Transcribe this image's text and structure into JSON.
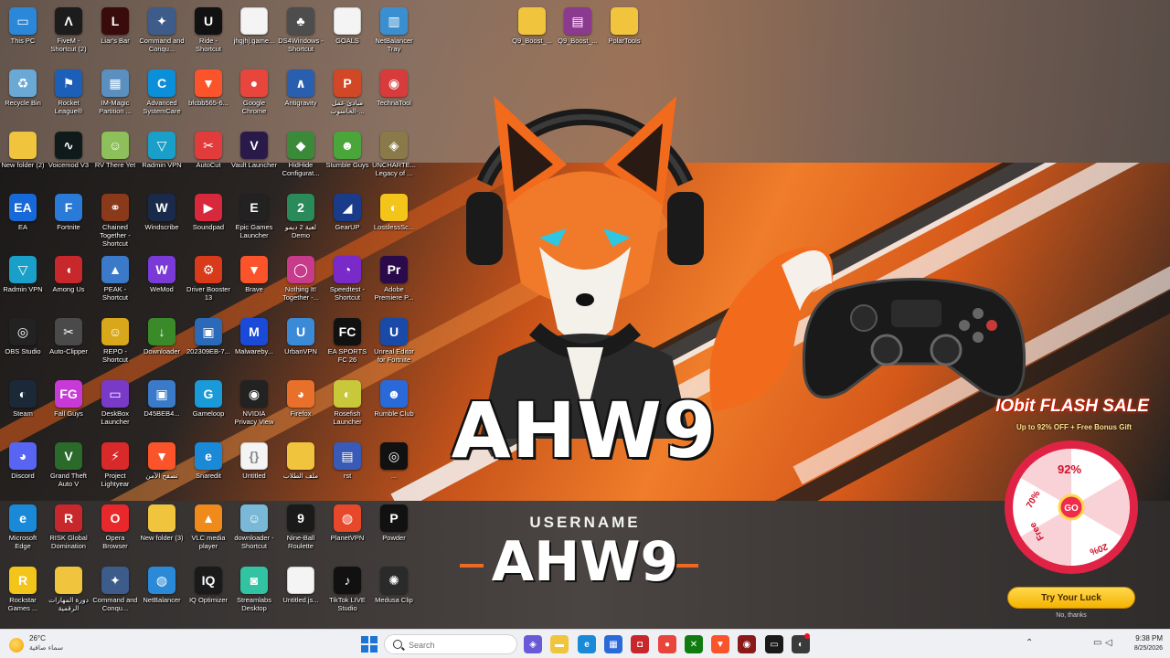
{
  "wallpaper": {
    "brand_text": "AHW9",
    "username_label": "USERNAME",
    "username_value": "AHW9"
  },
  "desktop_icons": [
    {
      "label": "This PC",
      "icon": "monitor-icon",
      "color": "#2b87d8",
      "glyph": "▭"
    },
    {
      "label": "FiveM - Shortcut (2)",
      "icon": "fivem-icon",
      "color": "#1c1c1c",
      "glyph": "Λ"
    },
    {
      "label": "Liar's Bar",
      "icon": "liars-bar-icon",
      "color": "#3a0b0b",
      "glyph": "L"
    },
    {
      "label": "Command and Conqu...",
      "icon": "command-conquer-icon",
      "color": "#3d5c8a",
      "glyph": "✦"
    },
    {
      "label": "Ride - Shortcut",
      "icon": "unreal-icon",
      "color": "#111111",
      "glyph": "U"
    },
    {
      "label": "jhgjhj.game...",
      "icon": "document-icon",
      "color": "#f4f4f4",
      "glyph": ""
    },
    {
      "label": "DS4Windows - Shortcut",
      "icon": "ds4windows-icon",
      "color": "#4d4d4d",
      "glyph": "♣"
    },
    {
      "label": "GOALS",
      "icon": "document-icon",
      "color": "#f4f4f4",
      "glyph": ""
    },
    {
      "label": "NetBalancer Tray",
      "icon": "netbalancer-icon",
      "color": "#3a8fd0",
      "glyph": "▥"
    },
    {
      "label": "Q9_Boost_...",
      "icon": "folder-icon",
      "color": "#f0c43c",
      "glyph": ""
    },
    {
      "label": "Q9_Boost_...",
      "icon": "winrar-icon",
      "color": "#8b3a8f",
      "glyph": "▤"
    },
    {
      "label": "PolarTools",
      "icon": "folder-icon",
      "color": "#f0c43c",
      "glyph": ""
    },
    {
      "label": "Recycle Bin",
      "icon": "recycle-bin-icon",
      "color": "#6aa9d6",
      "glyph": "♻"
    },
    {
      "label": "Rocket League®",
      "icon": "rocket-league-icon",
      "color": "#1b5fb8",
      "glyph": "⚑"
    },
    {
      "label": "IM-Magic Partition ...",
      "icon": "im-magic-icon",
      "color": "#5a8fc0",
      "glyph": "▦"
    },
    {
      "label": "Advanced SystemCare",
      "icon": "advanced-systemcare-icon",
      "color": "#0b8fd8",
      "glyph": "C"
    },
    {
      "label": "bfcbb565-6...",
      "icon": "brave-icon",
      "color": "#fb542b",
      "glyph": "▼"
    },
    {
      "label": "Google Chrome",
      "icon": "chrome-icon",
      "color": "#e8453c",
      "glyph": "●"
    },
    {
      "label": "Antigravity",
      "icon": "antigravity-icon",
      "color": "#2a5fb0",
      "glyph": "∧"
    },
    {
      "label": "مبادئ عمل الحاسوب-...",
      "icon": "powerpoint-icon",
      "color": "#d24726",
      "glyph": "P"
    },
    {
      "label": "TechnaTool",
      "icon": "technatool-icon",
      "color": "#d83b3b",
      "glyph": "◉"
    },
    {
      "label": "New folder (2)",
      "icon": "folder-icon",
      "color": "#f0c43c",
      "glyph": ""
    },
    {
      "label": "Voicemod V3",
      "icon": "voicemod-icon",
      "color": "#0f1a1a",
      "glyph": "∿"
    },
    {
      "label": "RV There Yet",
      "icon": "rv-there-yet-icon",
      "color": "#8dbf5a",
      "glyph": "☺"
    },
    {
      "label": "Radmin VPN",
      "icon": "radmin-vpn-icon",
      "color": "#1aa0c8",
      "glyph": "▽"
    },
    {
      "label": "AutoCut",
      "icon": "autocut-icon",
      "color": "#e23b3b",
      "glyph": "✂"
    },
    {
      "label": "Vault Launcher",
      "icon": "vault-launcher-icon",
      "color": "#2a1a4a",
      "glyph": "V"
    },
    {
      "label": "HidHide Configurat...",
      "icon": "hidhide-icon",
      "color": "#3a8a3a",
      "glyph": "◆"
    },
    {
      "label": "Stumble Guys",
      "icon": "stumble-guys-icon",
      "color": "#4aa63a",
      "glyph": "☻"
    },
    {
      "label": "UNCHARTE... Legacy of ...",
      "icon": "uncharted-icon",
      "color": "#8a7a4a",
      "glyph": "◈"
    },
    {
      "label": "EA",
      "icon": "ea-icon",
      "color": "#1768d8",
      "glyph": "EA"
    },
    {
      "label": "Fortnite",
      "icon": "fortnite-icon",
      "color": "#2a7ad8",
      "glyph": "F"
    },
    {
      "label": "Chained Together - Shortcut",
      "icon": "chained-together-icon",
      "color": "#8a3a1a",
      "glyph": "⚭"
    },
    {
      "label": "Windscribe",
      "icon": "windscribe-icon",
      "color": "#1a2a4a",
      "glyph": "W"
    },
    {
      "label": "Soundpad",
      "icon": "soundpad-icon",
      "color": "#d8283b",
      "glyph": "▶"
    },
    {
      "label": "Epic Games Launcher",
      "icon": "epic-games-icon",
      "color": "#222222",
      "glyph": "E"
    },
    {
      "label": "لعبة 2 ديمو Demo",
      "icon": "game-demo-icon",
      "color": "#2a8a5a",
      "glyph": "2"
    },
    {
      "label": "GearUP",
      "icon": "gearup-icon",
      "color": "#1a3a8a",
      "glyph": "◢"
    },
    {
      "label": "LosslessSc...",
      "icon": "lossless-scaling-icon",
      "color": "#f3c41a",
      "glyph": "◐"
    },
    {
      "label": "Radmin VPN",
      "icon": "radmin-vpn-icon",
      "color": "#1aa0c8",
      "glyph": "▽"
    },
    {
      "label": "Among Us",
      "icon": "among-us-icon",
      "color": "#c8282b",
      "glyph": "◖"
    },
    {
      "label": "PEAK - Shortcut",
      "icon": "peak-icon",
      "color": "#3a7ac8",
      "glyph": "▲"
    },
    {
      "label": "WeMod",
      "icon": "wemod-icon",
      "color": "#7a3ad8",
      "glyph": "W"
    },
    {
      "label": "Driver Booster 13",
      "icon": "driver-booster-icon",
      "color": "#d83a1a",
      "glyph": "⚙"
    },
    {
      "label": "Brave",
      "icon": "brave-icon",
      "color": "#fb542b",
      "glyph": "▼"
    },
    {
      "label": "Nothing It! Together -...",
      "icon": "nothing-together-icon",
      "color": "#c83a8a",
      "glyph": "◯"
    },
    {
      "label": "Speedtest - Shortcut",
      "icon": "speedtest-icon",
      "color": "#7a2ac8",
      "glyph": "◔"
    },
    {
      "label": "Adobe Premiere P...",
      "icon": "premiere-pro-icon",
      "color": "#2a0a4a",
      "glyph": "Pr"
    },
    {
      "label": "OBS Studio",
      "icon": "obs-icon",
      "color": "#222222",
      "glyph": "◎"
    },
    {
      "label": "Auto-Clipper",
      "icon": "auto-clipper-icon",
      "color": "#4a4a4a",
      "glyph": "✂"
    },
    {
      "label": "REPO - Shortcut",
      "icon": "repo-icon",
      "color": "#d8a81a",
      "glyph": "☺"
    },
    {
      "label": "Downloader",
      "icon": "downloader-icon",
      "color": "#3a8a2a",
      "glyph": "↓"
    },
    {
      "label": "202309EB-7...",
      "icon": "image-icon",
      "color": "#2a6ab8",
      "glyph": "▣"
    },
    {
      "label": "Malwareby...",
      "icon": "malwarebytes-icon",
      "color": "#1a4ad8",
      "glyph": "M"
    },
    {
      "label": "UrbanVPN",
      "icon": "urban-vpn-icon",
      "color": "#3a8ad8",
      "glyph": "U"
    },
    {
      "label": "EA SPORTS FC 26",
      "icon": "ea-fc-icon",
      "color": "#111111",
      "glyph": "FC"
    },
    {
      "label": "Unreal Editor for Fortnite",
      "icon": "unreal-editor-icon",
      "color": "#1a4aa8",
      "glyph": "U"
    },
    {
      "label": "Steam",
      "icon": "steam-icon",
      "color": "#1b2838",
      "glyph": "◐"
    },
    {
      "label": "Fall Guys",
      "icon": "fall-guys-icon",
      "color": "#c83ad8",
      "glyph": "FG"
    },
    {
      "label": "DeskBox Launcher",
      "icon": "deskbox-icon",
      "color": "#7a3ac8",
      "glyph": "▭"
    },
    {
      "label": "D45BEB4...",
      "icon": "image-icon",
      "color": "#3a7ac8",
      "glyph": "▣"
    },
    {
      "label": "Gameloop",
      "icon": "gameloop-icon",
      "color": "#1a9ad8",
      "glyph": "G"
    },
    {
      "label": "NVIDIA Privacy View",
      "icon": "privacy-view-icon",
      "color": "#222222",
      "glyph": "◉"
    },
    {
      "label": "Firefox",
      "icon": "firefox-icon",
      "color": "#e8702a",
      "glyph": "◕"
    },
    {
      "label": "Rosefish Launcher",
      "icon": "rosefish-icon",
      "color": "#c8c83a",
      "glyph": "◐"
    },
    {
      "label": "Rumble Club",
      "icon": "rumble-club-icon",
      "color": "#2a6ad8",
      "glyph": "☻"
    },
    {
      "label": "Discord",
      "icon": "discord-icon",
      "color": "#5865f2",
      "glyph": "◕"
    },
    {
      "label": "Grand Theft Auto V",
      "icon": "gta-v-icon",
      "color": "#2a6a2a",
      "glyph": "V"
    },
    {
      "label": "Project Lightyear",
      "icon": "project-icon",
      "color": "#d82a2a",
      "glyph": "⚡"
    },
    {
      "label": "تصفح الآمن",
      "icon": "brave-icon",
      "color": "#fb542b",
      "glyph": "▼"
    },
    {
      "label": "Snaredit",
      "icon": "edge-icon",
      "color": "#1a8ad8",
      "glyph": "e"
    },
    {
      "label": "Untitled",
      "icon": "json-file-icon",
      "color": "#f4f4f4",
      "glyph": "{}"
    },
    {
      "label": "ملف الطلاب",
      "icon": "folder-icon",
      "color": "#f0c43c",
      "glyph": ""
    },
    {
      "label": "rst",
      "icon": "rst-icon",
      "color": "#3a5ab8",
      "glyph": "▤"
    },
    {
      "label": "...",
      "icon": "spiral-icon",
      "color": "#111111",
      "glyph": "◎"
    },
    {
      "label": "Microsoft Edge",
      "icon": "edge-icon",
      "color": "#1a8ad8",
      "glyph": "e"
    },
    {
      "label": "RISK Global Domination",
      "icon": "risk-icon",
      "color": "#c8282b",
      "glyph": "R"
    },
    {
      "label": "Opera Browser",
      "icon": "opera-icon",
      "color": "#e8282b",
      "glyph": "O"
    },
    {
      "label": "New folder (3)",
      "icon": "folder-icon",
      "color": "#f0c43c",
      "glyph": ""
    },
    {
      "label": "VLC media player",
      "icon": "vlc-icon",
      "color": "#f08a1a",
      "glyph": "▲"
    },
    {
      "label": "downloader - Shortcut",
      "icon": "anime-icon",
      "color": "#7ab8d8",
      "glyph": "☺"
    },
    {
      "label": "Nine-Ball Roulette",
      "icon": "nine-ball-roulette-icon",
      "color": "#1a1a1a",
      "glyph": "9"
    },
    {
      "label": "PlanetVPN",
      "icon": "planet-vpn-icon",
      "color": "#e8482a",
      "glyph": "◍"
    },
    {
      "label": "Powder",
      "icon": "powder-icon",
      "color": "#111111",
      "glyph": "P"
    },
    {
      "label": "Rockstar Games ...",
      "icon": "rockstar-icon",
      "color": "#f3c41a",
      "glyph": "R"
    },
    {
      "label": "دورة المهارات الرقمية",
      "icon": "folder-icon",
      "color": "#f0c43c",
      "glyph": ""
    },
    {
      "label": "Command and Conqu...",
      "icon": "command-conquer-icon",
      "color": "#3d5c8a",
      "glyph": "✦"
    },
    {
      "label": "NetBalancer",
      "icon": "netbalancer-globe-icon",
      "color": "#2a8ad8",
      "glyph": "◍"
    },
    {
      "label": "IQ Optimizer",
      "icon": "iq-optimizer-icon",
      "color": "#1a1a1a",
      "glyph": "IQ"
    },
    {
      "label": "Streamlabs Desktop",
      "icon": "streamlabs-icon",
      "color": "#31c3a2",
      "glyph": "◙"
    },
    {
      "label": "Untitled.js...",
      "icon": "document-icon",
      "color": "#f4f4f4",
      "glyph": ""
    },
    {
      "label": "TikTok LIVE Studio",
      "icon": "tiktok-icon",
      "color": "#111111",
      "glyph": "♪"
    },
    {
      "label": "Medusa Clip",
      "icon": "medusa-clip-icon",
      "color": "#2a2a2a",
      "glyph": "✺"
    }
  ],
  "promo": {
    "title": "IObit FLASH SALE",
    "subtitle": "Up to 92% OFF + Free Bonus Gift",
    "wheel_center": "GO",
    "wheel_labels": [
      "92%",
      "70%",
      "Free",
      "20%"
    ],
    "button_label": "Try Your Luck",
    "dismiss_label": "No, thanks"
  },
  "taskbar": {
    "weather_temp": "26°C",
    "weather_cond": "سماء صافية",
    "search_placeholder": "Search",
    "apps": [
      {
        "name": "copilot-icon",
        "color": "#6a5ad8",
        "glyph": "◈"
      },
      {
        "name": "file-explorer-icon",
        "color": "#f0c43c",
        "glyph": "▬"
      },
      {
        "name": "edge-icon",
        "color": "#1a8ad8",
        "glyph": "e"
      },
      {
        "name": "microsoft-store-icon",
        "color": "#2a6ad8",
        "glyph": "▦"
      },
      {
        "name": "app-icon",
        "color": "#c8282b",
        "glyph": "◘"
      },
      {
        "name": "chrome-icon",
        "color": "#e8453c",
        "glyph": "●"
      },
      {
        "name": "xbox-icon",
        "color": "#107c10",
        "glyph": "✕"
      },
      {
        "name": "brave-icon",
        "color": "#fb542b",
        "glyph": "▼"
      },
      {
        "name": "game-launcher-icon",
        "color": "#8a1a1a",
        "glyph": "◉"
      },
      {
        "name": "terminal-icon",
        "color": "#1a1a1a",
        "glyph": "▭"
      },
      {
        "name": "media-icon",
        "color": "#3a3a3a",
        "glyph": "◐"
      }
    ],
    "time": "9:38 PM",
    "date": "8/25/2026"
  }
}
